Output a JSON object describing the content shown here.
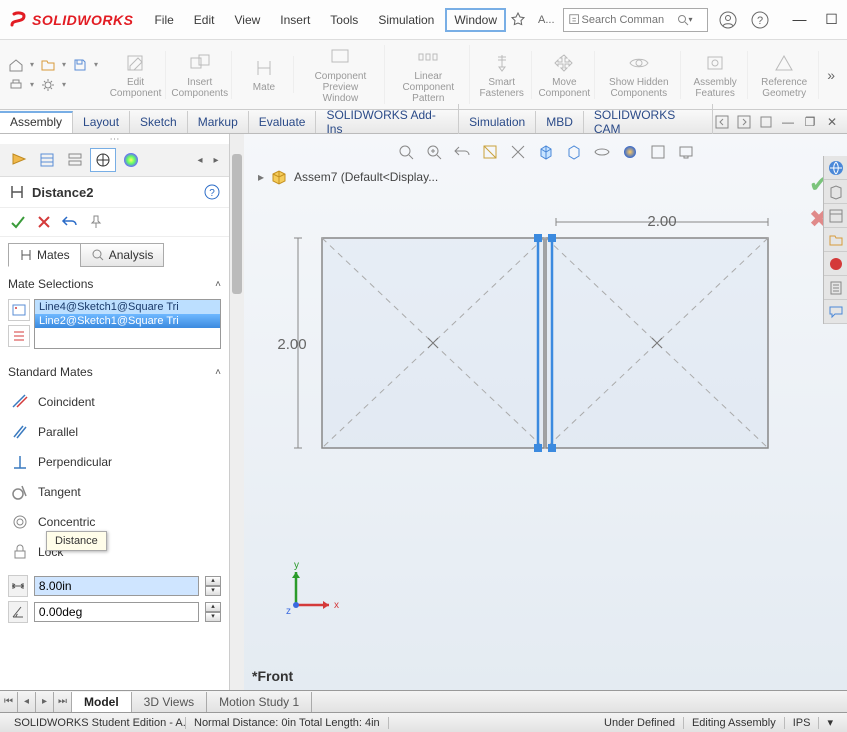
{
  "app": {
    "brand": "SOLIDWORKS",
    "menu": [
      "File",
      "Edit",
      "View",
      "Insert",
      "Tools",
      "Simulation",
      "Window"
    ],
    "active_menu": "Window",
    "search_placeholder": "Search Comman",
    "doc_label": "A..."
  },
  "ribbon": {
    "groups": [
      {
        "label": "Edit Component"
      },
      {
        "label": "Insert Components"
      },
      {
        "label": "Mate"
      },
      {
        "label": "Component Preview Window"
      },
      {
        "label": "Linear Component Pattern"
      },
      {
        "label": "Smart Fasteners"
      },
      {
        "label": "Move Component"
      },
      {
        "label": "Show Hidden Components"
      },
      {
        "label": "Assembly Features"
      },
      {
        "label": "Reference Geometry"
      }
    ]
  },
  "main_tabs": [
    "Assembly",
    "Layout",
    "Sketch",
    "Markup",
    "Evaluate",
    "SOLIDWORKS Add-Ins",
    "Simulation",
    "MBD",
    "SOLIDWORKS CAM"
  ],
  "active_main_tab": "Assembly",
  "panel": {
    "title": "Distance2",
    "subtab_mates": "Mates",
    "subtab_analysis": "Analysis",
    "mate_selections_label": "Mate Selections",
    "selections": [
      "Line4@Sketch1@Square Tri",
      "Line2@Sketch1@Square Tri"
    ],
    "standard_mates_label": "Standard Mates",
    "mates": {
      "coincident": "Coincident",
      "parallel": "Parallel",
      "perpendicular": "Perpendicular",
      "tangent": "Tangent",
      "concentric": "Concentric",
      "lock": "Lock"
    },
    "distance_tooltip": "Distance",
    "distance_value": "8.00in",
    "angle_value": "0.00deg"
  },
  "viewport": {
    "breadcrumb": "Assem7  (Default<Display...",
    "dim_h": "2.00",
    "dim_w": "2.00",
    "view_label": "*Front"
  },
  "bottom_tabs": [
    "Model",
    "3D Views",
    "Motion Study 1"
  ],
  "active_bottom_tab": "Model",
  "status": {
    "left": "SOLIDWORKS Student Edition - A...",
    "distance": "Normal Distance: 0in Total Length: 4in",
    "defined": "Under Defined",
    "mode": "Editing Assembly",
    "units": "IPS"
  }
}
